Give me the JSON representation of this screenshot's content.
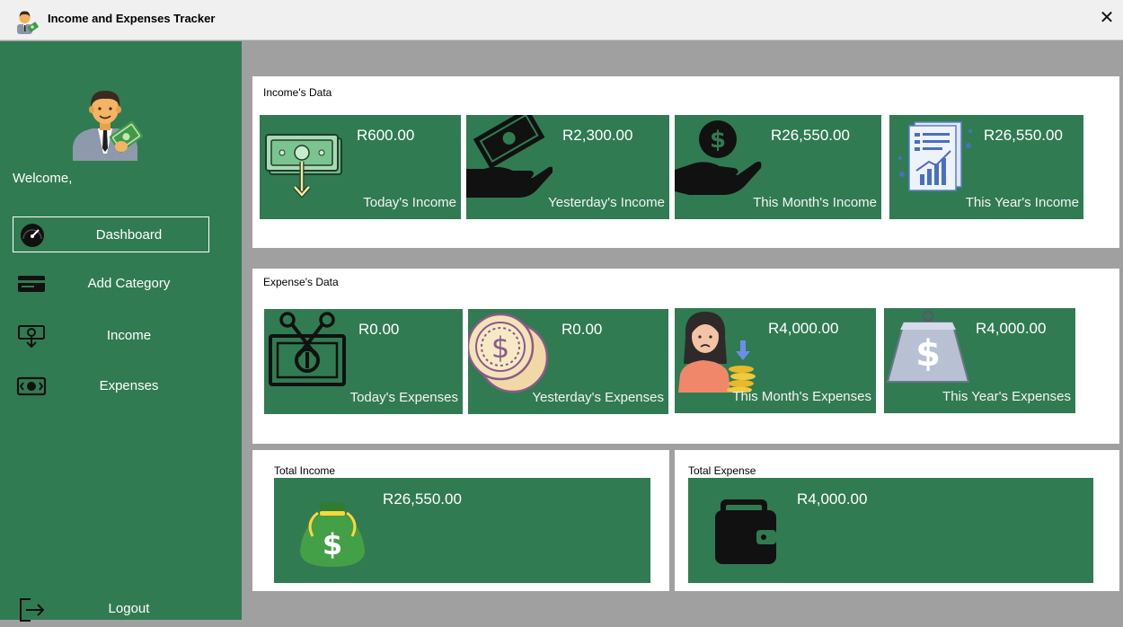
{
  "window": {
    "title": "Income and Expenses Tracker",
    "close_glyph": "✕"
  },
  "sidebar": {
    "welcome": "Welcome,",
    "items": [
      {
        "label": "Dashboard",
        "icon": "speedometer-icon",
        "active": true
      },
      {
        "label": "Add Category",
        "icon": "card-icon"
      },
      {
        "label": "Income",
        "icon": "money-in-icon"
      },
      {
        "label": "Expenses",
        "icon": "money-out-icon"
      }
    ],
    "logout": {
      "label": "Logout",
      "icon": "logout-icon"
    }
  },
  "income": {
    "title": "Income's Data",
    "cards": [
      {
        "amount": "R600.00",
        "label": "Today's Income",
        "icon": "banknote-down-icon"
      },
      {
        "amount": "R2,300.00",
        "label": "Yesterday's Income",
        "icon": "hand-money-icon"
      },
      {
        "amount": "R26,550.00",
        "label": "This Month's Income",
        "icon": "hand-coin-icon"
      },
      {
        "amount": "R26,550.00",
        "label": "This Year's Income",
        "icon": "report-chart-icon"
      }
    ]
  },
  "expenses": {
    "title": "Expense's Data",
    "cards": [
      {
        "amount": "R0.00",
        "label": "Today's Expenses",
        "icon": "cut-money-icon"
      },
      {
        "amount": "R0.00",
        "label": "Yesterday's Expenses",
        "icon": "coins-icon"
      },
      {
        "amount": "R4,000.00",
        "label": "This Month's Expenses",
        "icon": "sad-woman-coins-icon"
      },
      {
        "amount": "R4,000.00",
        "label": "This Year's Expenses",
        "icon": "dollar-weight-icon"
      }
    ]
  },
  "totals": {
    "income": {
      "title": "Total Income",
      "amount": "R26,550.00",
      "icon": "money-bag-icon"
    },
    "expense": {
      "title": "Total Expense",
      "amount": "R4,000.00",
      "icon": "wallet-icon"
    }
  },
  "colors": {
    "sidebar": "#317b52",
    "card": "#317b52",
    "background": "#a0a0a0",
    "panel": "#ffffff"
  }
}
